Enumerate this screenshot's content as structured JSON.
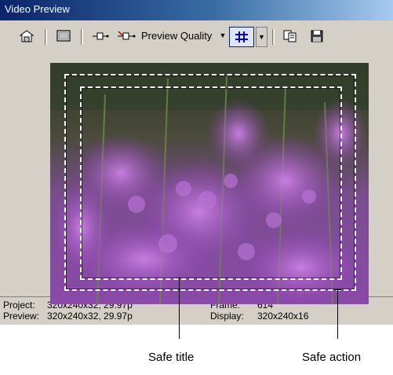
{
  "window": {
    "title": "Video Preview"
  },
  "toolbar": {
    "preview_quality_label": "Preview Quality",
    "icons": [
      "properties-icon",
      "external-monitor-icon",
      "copy-frame-icon",
      "split-screen-icon",
      "overlays-icon",
      "dropdown-arrow-icon",
      "copy-snapshot-icon",
      "save-snapshot-icon"
    ]
  },
  "status": {
    "project_label": "Project:",
    "project_value": "320x240x32, 29.97p",
    "preview_label": "Preview:",
    "preview_value": "320x240x32, 29.97p",
    "frame_label": "Frame:",
    "frame_value": "614",
    "display_label": "Display:",
    "display_value": "320x240x16"
  },
  "callouts": {
    "safe_title": "Safe title",
    "safe_action": "Safe action"
  },
  "colors": {
    "title_bar_start": "#0a246a",
    "title_bar_end": "#a6caf0",
    "window_bg": "#d4d0c8",
    "flower": "#a25cc4",
    "foliage": "#3d5a2e"
  }
}
